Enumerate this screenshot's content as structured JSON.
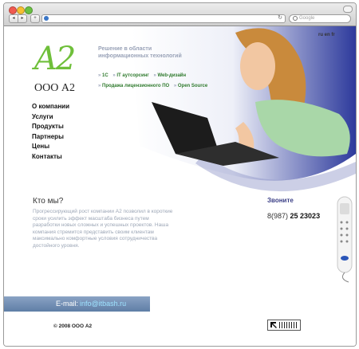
{
  "browser": {
    "nav_back": "◂",
    "nav_forward": "▸",
    "nav_add": "+",
    "reload": "↻",
    "search_placeholder": "Google"
  },
  "site": {
    "logo_mark": "A2",
    "logo_company": "ООО А2",
    "tagline": "Решение в области информационных технологий",
    "languages": "ru en fr",
    "services": [
      "1С",
      "IT аутсорсинг",
      "Web-дизайн",
      "Продажа лицензионного ПО",
      "Open Source"
    ],
    "menu": [
      "О компании",
      "Услуги",
      "Продукты",
      "Партнеры",
      "Цены",
      "Контакты"
    ],
    "who_title": "Кто мы?",
    "who_text": "Прогрессирующий рост компании А2 позволил в короткие сроки усилить эффект масштаба бизнеса путем разработки новых сложных и успешных проектов. Наша компания стремится представить своим клиентам максимально комфортные условия сотрудничества достойного уровня.",
    "call_title": "Звоните",
    "phone_code": "8(987)",
    "phone_number": "25 23023",
    "email_label": "E-mail:",
    "email": "info@itbash.ru",
    "copyright": "© 2008 ООО А2"
  },
  "colors": {
    "logo_green": "#6fbf3a",
    "link_green": "#2f7a2d",
    "heading_blue": "#3b3f86",
    "email_bar": "#6f8db3"
  }
}
